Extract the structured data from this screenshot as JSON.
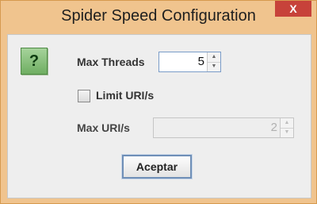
{
  "window": {
    "title": "Spider Speed Configuration",
    "close_label": "X"
  },
  "dialog": {
    "help_icon_glyph": "?",
    "max_threads": {
      "label": "Max Threads",
      "value": "5"
    },
    "limit_uri": {
      "label": "Limit URI/s",
      "checked": false
    },
    "max_uri": {
      "label": "Max URI/s",
      "value": "2",
      "enabled": false
    },
    "accept_label": "Aceptar"
  },
  "icons": {
    "up": "▲",
    "down": "▼"
  },
  "colors": {
    "title_bar": "#f0c48e",
    "close_button": "#c7423a",
    "dialog_background": "#eeeeee",
    "help_icon": "#7cbf6e"
  }
}
